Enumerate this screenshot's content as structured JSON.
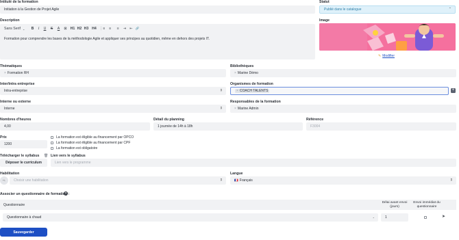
{
  "title_section": {
    "label": "Intitulé de la formation",
    "value": "Initiation à la Gestion de Projet Agile"
  },
  "status": {
    "label": "Statut",
    "value": "Publié dans le catalogue"
  },
  "description": {
    "label": "Description",
    "font_select": "Sans Serif",
    "toolbar_icons": [
      "bold-icon",
      "italic-icon",
      "underline-icon",
      "strikethrough-icon",
      "text-color-icon",
      "highlight-icon",
      "heading-1-icon",
      "heading-2-icon",
      "heading-3-icon",
      "heading-4-icon",
      "ordered-list-icon",
      "bullet-list-icon",
      "align-icon",
      "indent-icon",
      "outdent-icon",
      "link-icon"
    ],
    "toolbar_glyphs": [
      "B",
      "I",
      "U",
      "S",
      "A",
      "⊠",
      "H1",
      "H2",
      "H3",
      "H4",
      "⋮≡",
      "≡",
      "≡",
      "⇥",
      "⇤",
      "🔗"
    ],
    "text": "Formation pour comprendre les bases de la méthodologie Agile et appliquer ses principes au quotidien, même en dehors des projets IT."
  },
  "image": {
    "label": "Image",
    "modify_link": "Modifier"
  },
  "thematiques": {
    "label": "Thématiques",
    "tag": "Formation RH"
  },
  "bibliotheques": {
    "label": "Bibliothèques",
    "tag": "Marine Démo"
  },
  "inter_intra": {
    "label": "Inter/intra entreprise",
    "value": "Intra-entreprise"
  },
  "organismes": {
    "label": "Organismes de formation",
    "tag": "COACH TALENTS",
    "add": "+"
  },
  "interne_externe": {
    "label": "Interne ou externe",
    "value": "Interne"
  },
  "responsables": {
    "label": "Responsables de la formation",
    "tag": "Marine Admin"
  },
  "heures": {
    "label": "Nombres d'heures",
    "value": "4,00"
  },
  "planning": {
    "label": "Détail du planning",
    "value": "1 journée de 14h à 18h"
  },
  "reference": {
    "label": "Référence",
    "placeholder": "F3004"
  },
  "prix": {
    "label": "Prix",
    "value": "1200"
  },
  "checkboxes": [
    "La formation est éligible au financement par OPCO",
    "La formation est éligible au financement par CPF",
    "La formation est obligatoire"
  ],
  "syllabus": {
    "label": "Télécharger le syllabus",
    "button": "Déposer le curriculum",
    "link_label": "Lien vers le syllabus",
    "link_placeholder": "Lien vers le programme"
  },
  "habilitation": {
    "label": "Habilitation",
    "placeholder": "Choisir une habilitation",
    "prefix": "+/-"
  },
  "langue": {
    "label": "Langue",
    "flag": "🇫🇷",
    "value": "Français"
  },
  "questionnaire": {
    "label": "Associer un questionnaire de formation :",
    "col_questionnaire": "Questionnaire",
    "col_delai": "Délai avant envoi (jours)",
    "col_envoi": "Envoi immédiat du questionnaire",
    "row_value": "Questionnaire à chaud",
    "row_delai": "1"
  },
  "save_button": "Sauvegarder",
  "colors": {
    "primary": "#1d4fc4",
    "field_bg": "#f1f2f4",
    "status_bg": "#dff1fa",
    "banner_pink": "#f26c9c"
  }
}
